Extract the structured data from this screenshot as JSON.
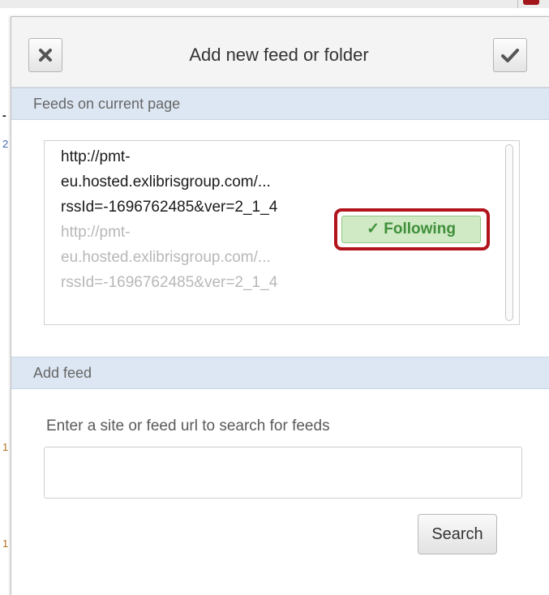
{
  "background_page": {
    "left_edge_marks": [
      "-",
      "2",
      "1",
      "1"
    ]
  },
  "dialog": {
    "title": "Add new feed or folder",
    "close_icon": "x-icon",
    "confirm_icon": "check-icon"
  },
  "feeds_section": {
    "header": "Feeds on current page",
    "items": [
      {
        "lines": [
          "http://pmt-",
          "eu.hosted.exlibrisgroup.com/...",
          "rssId=-1696762485&ver=2_1_4"
        ],
        "status": "following"
      },
      {
        "lines": [
          "http://pmt-",
          "eu.hosted.exlibrisgroup.com/...",
          "rssId=-1696762485&ver=2_1_4"
        ],
        "status": "muted"
      }
    ],
    "following_label": "✓ Following"
  },
  "add_section": {
    "header": "Add feed",
    "prompt": "Enter a site or feed url to search for feeds",
    "input_value": "",
    "input_placeholder": "",
    "search_label": "Search"
  },
  "colors": {
    "section_bar": "#dde7f3",
    "following_bg": "#cfeac4",
    "following_text": "#3f8f3a",
    "highlight_border": "#b2141c"
  }
}
